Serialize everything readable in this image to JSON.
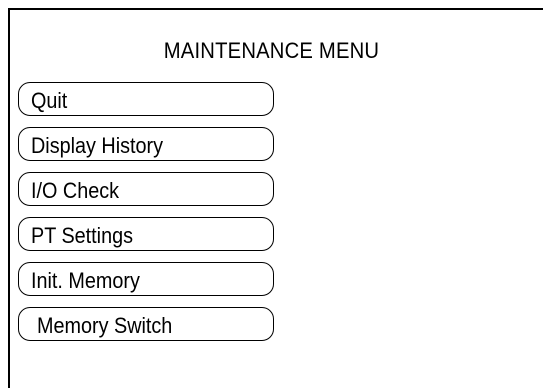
{
  "screen": {
    "title": "MAINTENANCE MENU"
  },
  "menu": {
    "items": [
      {
        "label": "Quit"
      },
      {
        "label": "Display History"
      },
      {
        "label": "I/O Check"
      },
      {
        "label": "PT Settings"
      },
      {
        "label": "Init. Memory"
      },
      {
        "label": "Memory Switch"
      }
    ]
  }
}
